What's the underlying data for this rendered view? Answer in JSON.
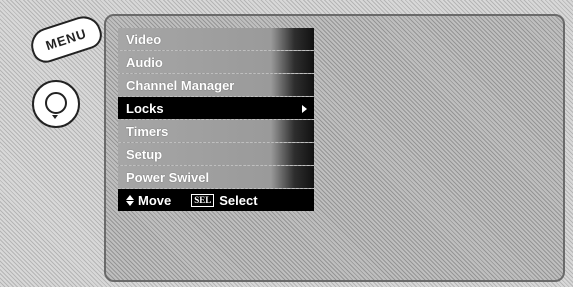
{
  "remote": {
    "menu_button_label": "MENU"
  },
  "menu": {
    "items": [
      {
        "label": "Video",
        "selected": false
      },
      {
        "label": "Audio",
        "selected": false
      },
      {
        "label": "Channel Manager",
        "selected": false
      },
      {
        "label": "Locks",
        "selected": true
      },
      {
        "label": "Timers",
        "selected": false
      },
      {
        "label": "Setup",
        "selected": false
      },
      {
        "label": "Power Swivel",
        "selected": false
      }
    ]
  },
  "help": {
    "move_label": "Move",
    "sel_key_label": "SEL",
    "select_label": "Select"
  }
}
